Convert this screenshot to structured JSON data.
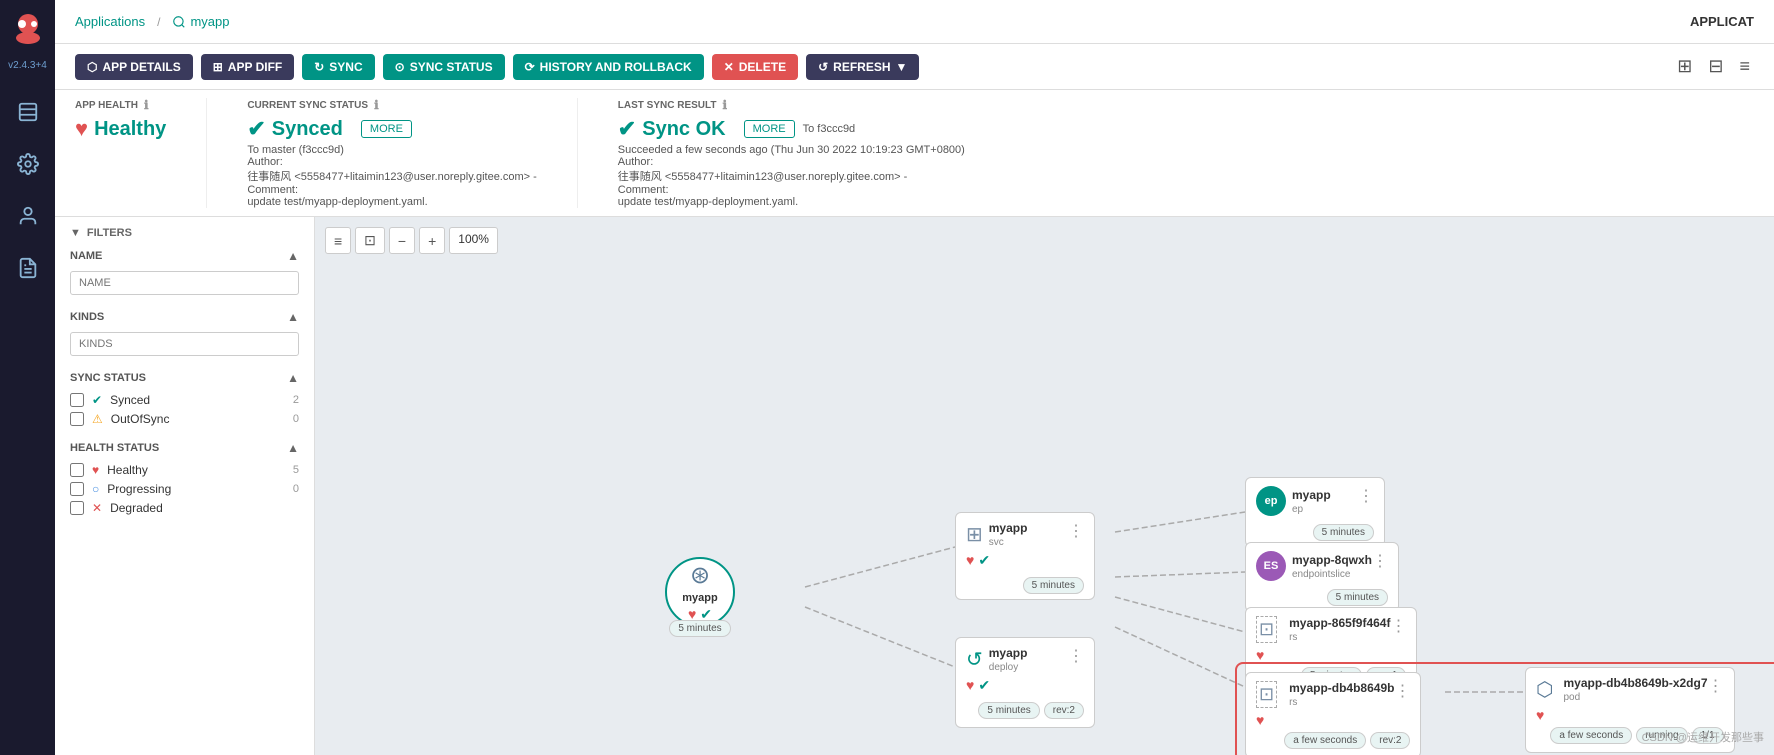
{
  "app": {
    "title": "APPLICAT",
    "version": "v2.4.3+4"
  },
  "breadcrumb": {
    "parent": "Applications",
    "current": "myapp"
  },
  "toolbar": {
    "app_details": "APP DETAILS",
    "app_diff": "APP DIFF",
    "sync": "SYNC",
    "sync_status": "SYNC STATUS",
    "history_rollback": "HISTORY AND ROLLBACK",
    "delete": "DELETE",
    "refresh": "REFRESH"
  },
  "status": {
    "app_health_label": "APP HEALTH",
    "app_health_value": "Healthy",
    "current_sync_label": "CURRENT SYNC STATUS",
    "current_sync_value": "Synced",
    "current_sync_detail": "To master (f3ccc9d)",
    "current_sync_author": "往事随风 <5558477+litaimin123@user.noreply.gitee.com> -",
    "current_sync_comment": "update test/myapp-deployment.yaml.",
    "last_sync_label": "LAST SYNC RESULT",
    "last_sync_value": "Sync OK",
    "last_sync_to": "To f3ccc9d",
    "last_sync_detail": "Succeeded a few seconds ago (Thu Jun 30 2022 10:19:23 GMT+0800)",
    "last_sync_author": "往事随风 <5558477+litaimin123@user.noreply.gitee.com> -",
    "last_sync_comment": "update test/myapp-deployment.yaml.",
    "more_label": "MORE"
  },
  "filters": {
    "title": "FILTERS",
    "name_label": "NAME",
    "name_placeholder": "NAME",
    "kinds_label": "KINDS",
    "kinds_placeholder": "KINDS",
    "sync_status_label": "SYNC STATUS",
    "synced_label": "Synced",
    "synced_count": "2",
    "outofsync_label": "OutOfSync",
    "outofsync_count": "0",
    "health_status_label": "HEALTH STATUS",
    "healthy_label": "Healthy",
    "healthy_count": "5",
    "progressing_label": "Progressing",
    "progressing_count": "0",
    "degraded_label": "Degraded"
  },
  "zoom_level": "100%",
  "nodes": {
    "root": {
      "name": "myapp",
      "badge": "5 minutes"
    },
    "svc": {
      "name": "myapp",
      "type": "svc",
      "badge": "5 minutes"
    },
    "deploy": {
      "name": "myapp",
      "type": "deploy",
      "badge_time": "5 minutes",
      "badge_rev": "rev:2"
    },
    "ep": {
      "name": "myapp",
      "type": "ep",
      "badge": "5 minutes"
    },
    "endpointslice": {
      "name": "myapp-8qwxh",
      "type": "endpointslice",
      "badge": "5 minutes"
    },
    "rs1": {
      "name": "myapp-865f9f464f",
      "type": "rs",
      "badge_time": "5 minutes",
      "badge_rev": "rev:1"
    },
    "rs2": {
      "name": "myapp-db4b8649b",
      "type": "rs",
      "badge_time": "a few seconds",
      "badge_rev": "rev:2"
    },
    "pod": {
      "name": "myapp-db4b8649b-x2dg7",
      "type": "pod",
      "badge_time": "a few seconds",
      "badge_running": "running",
      "badge_count": "1/1"
    }
  }
}
